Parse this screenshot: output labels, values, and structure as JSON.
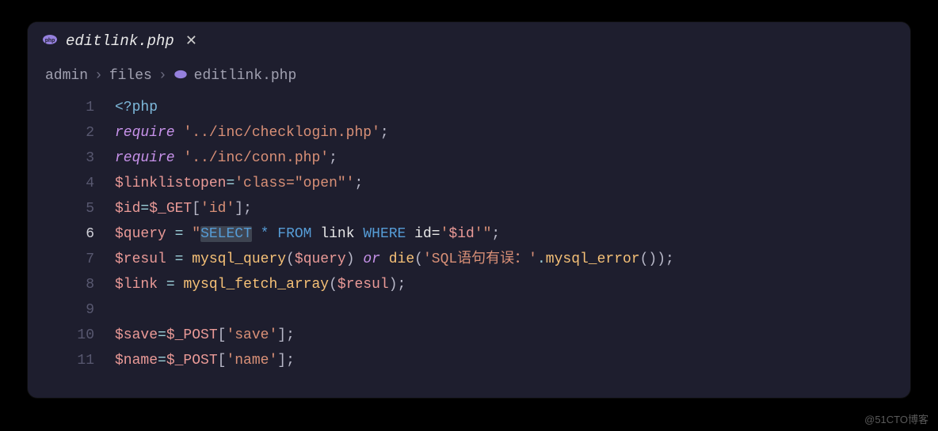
{
  "tab": {
    "title": "editlink.php",
    "icon": "php-icon"
  },
  "breadcrumb": {
    "items": [
      "admin",
      "files",
      "editlink.php"
    ]
  },
  "gutter": {
    "lines": [
      "1",
      "2",
      "3",
      "4",
      "5",
      "6",
      "7",
      "8",
      "9",
      "10",
      "11"
    ],
    "active": "6"
  },
  "code": {
    "l1": {
      "tag": "<?php"
    },
    "l2": {
      "kw": "require",
      "str": "'../inc/checklogin.php'",
      "end": ";"
    },
    "l3": {
      "kw": "require",
      "str": "'../inc/conn.php'",
      "end": ";"
    },
    "l4": {
      "var": "$linklistopen",
      "eq": "=",
      "str": "'class=\"open\"'",
      "end": ";"
    },
    "l5": {
      "var": "$id",
      "eq": "=",
      "var2": "$_GET",
      "br1": "[",
      "str": "'id'",
      "br2": "]",
      "end": ";"
    },
    "l6": {
      "var": "$query",
      "sp": " ",
      "eq": "=",
      "sp2": " ",
      "q1": "\"",
      "sel": "SELECT",
      "rest1": " * ",
      "from": "FROM",
      "sp3": " ",
      "tbl": "link",
      "sp4": " ",
      "where": "WHERE",
      "sp5": " ",
      "col": "id=",
      "q2": "'",
      "var2": "$id",
      "q3": "'",
      "q4": "\"",
      "end": ";"
    },
    "l7": {
      "var": "$resul",
      "sp": " ",
      "eq": "=",
      "sp2": " ",
      "fn": "mysql_query",
      "p1": "(",
      "var2": "$query",
      "p2": ")",
      "sp3": " ",
      "or": "or",
      "sp4": " ",
      "die": "die",
      "p3": "(",
      "str": "'SQL语句有误：'",
      "dot": ".",
      "fn2": "mysql_error",
      "p4": "()",
      "p5": ")",
      "end": ";"
    },
    "l8": {
      "var": "$link",
      "sp": " ",
      "eq": "=",
      "sp2": " ",
      "fn": "mysql_fetch_array",
      "p1": "(",
      "var2": "$resul",
      "p2": ")",
      "end": ";"
    },
    "l10": {
      "var": "$save",
      "eq": "=",
      "var2": "$_POST",
      "br1": "[",
      "str": "'save'",
      "br2": "]",
      "end": ";"
    },
    "l11": {
      "var": "$name",
      "eq": "=",
      "var2": "$_POST",
      "br1": "[",
      "str": "'name'",
      "br2": "]",
      "end": ";"
    }
  },
  "watermark": "@51CTO博客"
}
